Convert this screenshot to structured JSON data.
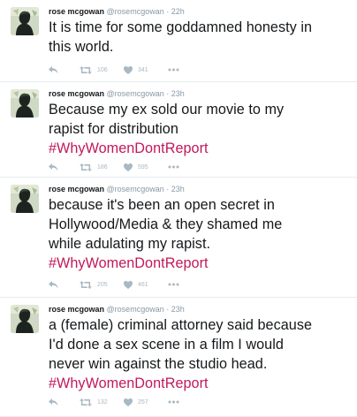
{
  "tweets": [
    {
      "name": "rose mcgowan",
      "handle": "@rosemcgowan",
      "separator": "·",
      "time": "22h",
      "lines": [
        "It is time for some goddamned honesty in",
        "this world."
      ],
      "hashtag": "",
      "retweets": "106",
      "likes": "341"
    },
    {
      "name": "rose mcgowan",
      "handle": "@rosemcgowan",
      "separator": "·",
      "time": "23h",
      "lines": [
        "Because my ex sold our movie to my",
        "rapist for distribution"
      ],
      "hashtag": "#WhyWomenDontReport",
      "retweets": "186",
      "likes": "595"
    },
    {
      "name": "rose mcgowan",
      "handle": "@rosemcgowan",
      "separator": "·",
      "time": "23h",
      "lines": [
        "because it's been an open secret in",
        "Hollywood/Media & they shamed me",
        "while adulating my rapist."
      ],
      "hashtag": "#WhyWomenDontReport",
      "retweets": "205",
      "likes": "461"
    },
    {
      "name": "rose mcgowan",
      "handle": "@rosemcgowan",
      "separator": "·",
      "time": "23h",
      "lines": [
        "a (female) criminal attorney said because",
        "I'd done a sex scene in a film I would",
        "never win against the studio head."
      ],
      "hashtag": "#WhyWomenDontReport",
      "retweets": "132",
      "likes": "257"
    }
  ],
  "icons": {
    "reply": "reply-icon",
    "retweet": "retweet-icon",
    "like": "heart-icon",
    "more": "more-icon"
  },
  "colors": {
    "hashtag": "#c2185b",
    "muted": "#8899a6",
    "icon": "#aab8c2"
  }
}
